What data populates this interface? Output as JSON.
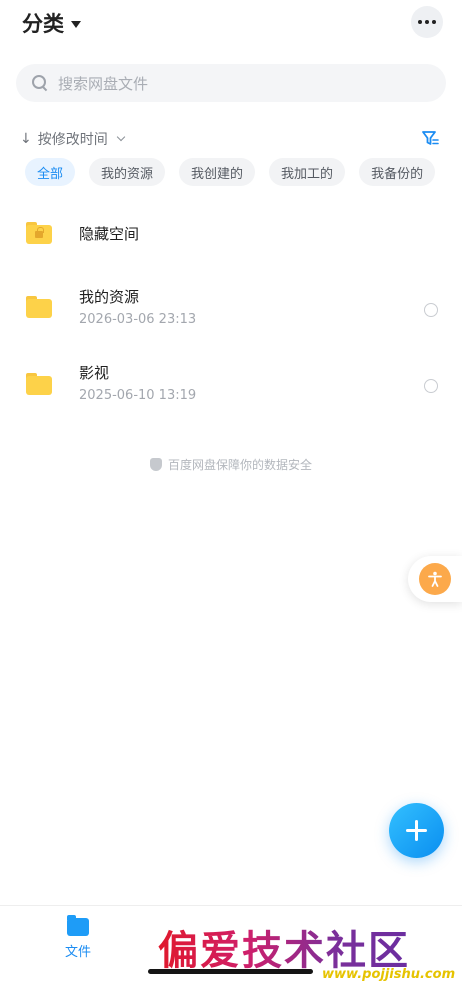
{
  "header": {
    "title": "分类",
    "title_icon": "caret-down-icon",
    "more_icon": "more-horizontal-icon"
  },
  "search": {
    "placeholder": "搜索网盘文件",
    "icon": "search-icon"
  },
  "sort": {
    "arrow": "↓",
    "label": "按修改时间",
    "chevron_icon": "chevron-down-icon",
    "filter_icon": "filter-icon"
  },
  "filters": [
    {
      "label": "全部",
      "active": true
    },
    {
      "label": "我的资源",
      "active": false
    },
    {
      "label": "我创建的",
      "active": false
    },
    {
      "label": "我加工的",
      "active": false
    },
    {
      "label": "我备份的",
      "active": false
    }
  ],
  "files": [
    {
      "name": "隐藏空间",
      "meta": "",
      "icon": "locked-folder-icon"
    },
    {
      "name": "我的资源",
      "meta": "2026-03-06  23:13",
      "icon": "folder-icon"
    },
    {
      "name": "影视",
      "meta": "2025-06-10  13:19",
      "icon": "folder-icon"
    }
  ],
  "safety_note": "百度网盘保障你的数据安全",
  "bottom_nav": {
    "files_label": "文件"
  },
  "watermark": {
    "text": "偏爱技术社区",
    "url": "www.pojjishu.com"
  },
  "colors": {
    "accent": "#1b8cf2",
    "folder": "#fdd249",
    "assist": "#fca94b"
  }
}
